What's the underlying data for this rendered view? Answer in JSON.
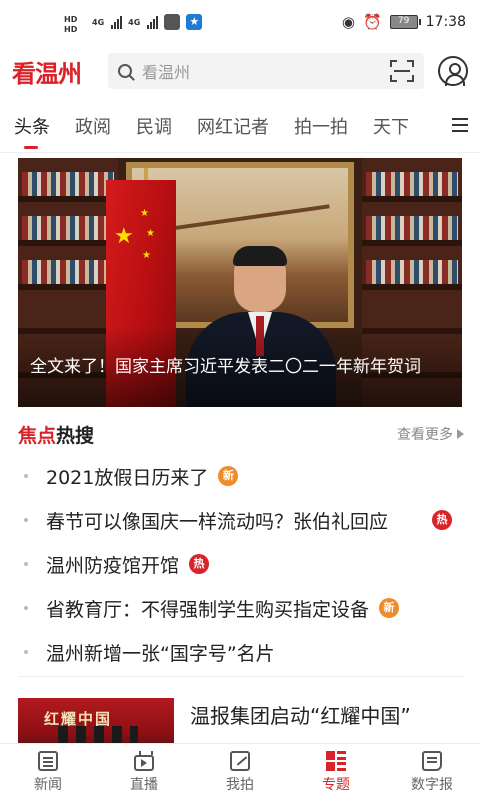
{
  "status_bar": {
    "hd_top": "HD",
    "hd_bottom": "HD",
    "net1": "4G",
    "net2": "4G",
    "battery": "79",
    "time": "17:38"
  },
  "header": {
    "logo": "看温州",
    "search_placeholder": "看温州"
  },
  "tabs": [
    {
      "label": "头条",
      "active": true
    },
    {
      "label": "政阅",
      "active": false
    },
    {
      "label": "民调",
      "active": false
    },
    {
      "label": "网红记者",
      "active": false
    },
    {
      "label": "拍一拍",
      "active": false
    },
    {
      "label": "天下",
      "active": false
    }
  ],
  "hero": {
    "caption": "全文来了！国家主席习近平发表二〇二一年新年贺词"
  },
  "hot": {
    "title_red": "焦点",
    "title_black": "热搜",
    "more": "查看更多",
    "items": [
      {
        "text": "2021放假日历来了",
        "badge": "新",
        "badge_type": "new"
      },
      {
        "text": "春节可以像国庆一样流动吗？张伯礼回应",
        "badge": "热",
        "badge_type": "hot"
      },
      {
        "text": "温州防疫馆开馆",
        "badge": "热",
        "badge_type": "hot"
      },
      {
        "text": "省教育厅：不得强制学生购买指定设备",
        "badge": "新",
        "badge_type": "new"
      },
      {
        "text": "温州新增一张“国字号”名片",
        "badge": "",
        "badge_type": ""
      }
    ]
  },
  "article": {
    "thumb_text": "红耀中国",
    "title": "温报集团启动“红耀中国”"
  },
  "bottom_nav": [
    {
      "label": "新闻",
      "icon": "news-icon",
      "active": false
    },
    {
      "label": "直播",
      "icon": "live-icon",
      "active": false
    },
    {
      "label": "我拍",
      "icon": "shoot-icon",
      "active": false
    },
    {
      "label": "专题",
      "icon": "topic-icon",
      "active": true
    },
    {
      "label": "数字报",
      "icon": "epaper-icon",
      "active": false
    }
  ],
  "colors": {
    "brand_red": "#d8232a",
    "badge_new": "#f08b2a",
    "badge_hot": "#d8232a"
  }
}
